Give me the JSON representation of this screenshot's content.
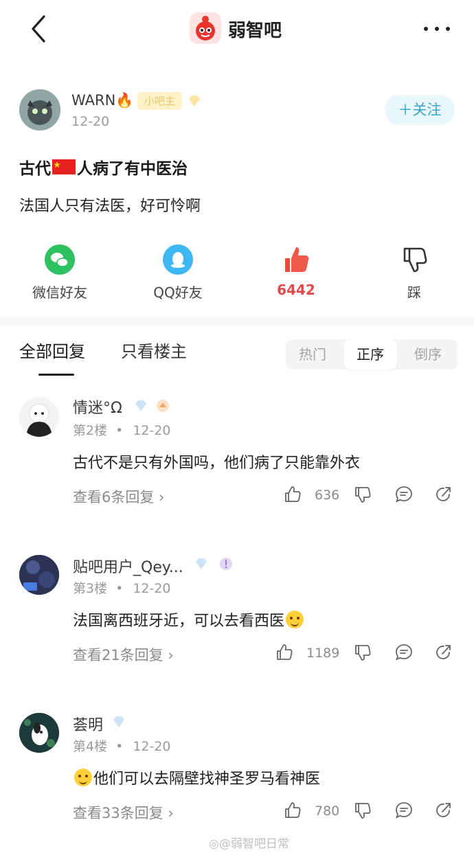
{
  "header": {
    "forum_name": "弱智吧"
  },
  "post": {
    "author": "WARN🔥",
    "badge": "小吧主",
    "date": "12-20",
    "follow_label": "＋关注",
    "title_prefix": "古代",
    "title_suffix": "人病了有中医治",
    "body": "法国人只有法医，好可怜啊"
  },
  "actions": {
    "wechat": "微信好友",
    "qq": "QQ好友",
    "like_count": "6442",
    "dislike": "踩"
  },
  "tabs": {
    "all": "全部回复",
    "op_only": "只看楼主",
    "hot": "热门",
    "asc": "正序",
    "desc": "倒序"
  },
  "comments": [
    {
      "name": "情迷°Ω",
      "floor": "第2楼",
      "date": "12-20",
      "text": "古代不是只有外国吗，他们病了只能靠外衣",
      "replies": "查看6条回复 ›",
      "likes": "636"
    },
    {
      "name": "贴吧用户_Qey...",
      "floor": "第3楼",
      "date": "12-20",
      "text": "法国离西班牙近，可以去看西医",
      "replies": "查看21条回复 ›",
      "likes": "1189"
    },
    {
      "name": "荟明",
      "floor": "第4楼",
      "date": "12-20",
      "text": "他们可以去隔壁找神圣罗马看神医",
      "replies": "查看33条回复 ›",
      "likes": "780"
    }
  ],
  "watermark": "◎@弱智吧日常",
  "colors": {
    "accent": "#37a6c8",
    "like": "#e04a4a",
    "wechat": "#2dc161",
    "qq": "#3db8f5"
  }
}
